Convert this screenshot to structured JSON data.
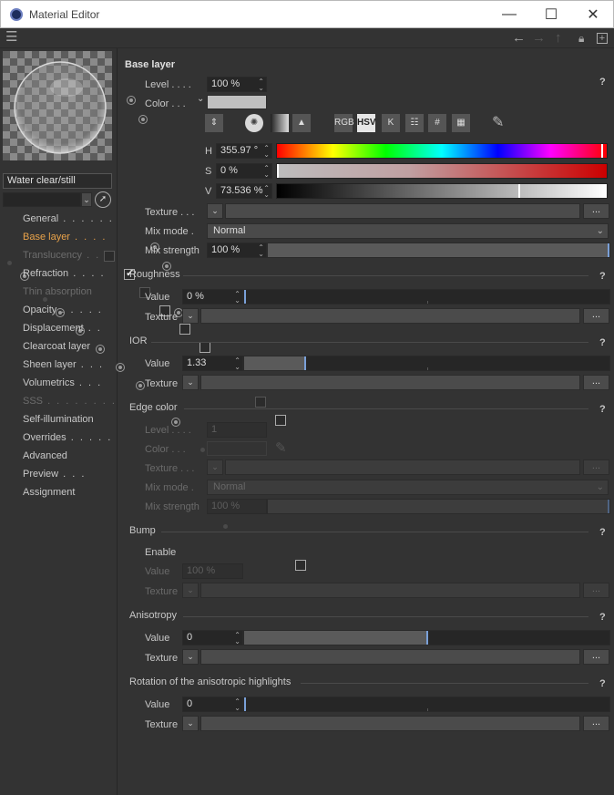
{
  "window": {
    "title": "Material Editor",
    "minimize_label": "—",
    "maximize_label": "☐",
    "close_label": "✕"
  },
  "sidebar": {
    "material_name": "Water clear/still",
    "items": [
      {
        "label": "General",
        "dots": ". . . . . .",
        "state": "none"
      },
      {
        "label": "Base layer",
        "dots": ". . . .",
        "state": "active"
      },
      {
        "label": "Translucency",
        "dots": ". .",
        "state": "disabled"
      },
      {
        "label": "Refraction",
        "dots": ". . . .",
        "state": "checked"
      },
      {
        "label": "Thin absorption",
        "dots": "",
        "state": "disabled"
      },
      {
        "label": "Opacity",
        "dots": ". . . . .",
        "state": "unchecked"
      },
      {
        "label": "Displacement",
        "dots": ". .",
        "state": "unchecked"
      },
      {
        "label": "Clearcoat layer",
        "dots": "",
        "state": "unchecked"
      },
      {
        "label": "Sheen layer",
        "dots": ". . .",
        "state": "unchecked"
      },
      {
        "label": "Volumetrics",
        "dots": ". . .",
        "state": "unchecked"
      },
      {
        "label": "SSS",
        "dots": ". . . . . . . .",
        "state": "disabled"
      },
      {
        "label": "Self-illumination",
        "dots": "",
        "state": "unchecked"
      },
      {
        "label": "Overrides",
        "dots": ". . . . .",
        "state": "none"
      },
      {
        "label": "Advanced",
        "dots": "",
        "state": "none"
      },
      {
        "label": "Preview",
        "dots": ". . .",
        "state": "none"
      },
      {
        "label": "Assignment",
        "dots": "",
        "state": "none"
      }
    ]
  },
  "base_layer": {
    "heading": "Base layer",
    "help": "?",
    "level_label": "Level . . . .",
    "level_value": "100 %",
    "level_fraction": 1.0,
    "color_label": "Color . . .",
    "color_swatch": "#bfbfbf",
    "color_modes": [
      "RGB",
      "HSV",
      "K"
    ],
    "selected_mode": "HSV",
    "h_label": "H",
    "h_value": "355.97 °",
    "h_fraction": 0.9888,
    "s_label": "S",
    "s_value": "0 %",
    "s_fraction": 0.0,
    "v_label": "V",
    "v_value": "73.536 %",
    "v_fraction": 0.73536,
    "texture_label": "Texture . . .",
    "ellipsis": "...",
    "mix_mode_label": "Mix mode .",
    "mix_mode_value": "Normal",
    "mix_strength_label": "Mix strength",
    "mix_strength_value": "100 %",
    "mix_strength_fraction": 1.0
  },
  "roughness": {
    "heading": "Roughness",
    "help": "?",
    "value_label": "Value",
    "value": "0 %",
    "value_fraction": 0.0,
    "texture_label": "Texture",
    "ellipsis": "..."
  },
  "ior": {
    "heading": "IOR",
    "help": "?",
    "value_label": "Value",
    "value": "1.33",
    "value_fraction": 0.165,
    "texture_label": "Texture",
    "ellipsis": "..."
  },
  "edge_color": {
    "heading": "Edge color",
    "help": "?",
    "level_label": "Level . . . .",
    "level_value": "1",
    "color_label": "Color . . .",
    "texture_label": "Texture . . .",
    "ellipsis": "...",
    "mix_mode_label": "Mix mode .",
    "mix_mode_value": "Normal",
    "mix_strength_label": "Mix strength",
    "mix_strength_value": "100 %",
    "mix_strength_fraction": 1.0
  },
  "bump": {
    "heading": "Bump",
    "help": "?",
    "enable_label": "Enable",
    "value_label": "Value",
    "value": "100 %",
    "texture_label": "Texture",
    "ellipsis": "..."
  },
  "anisotropy": {
    "heading": "Anisotropy",
    "help": "?",
    "value_label": "Value",
    "value": "0",
    "value_fraction": 0.5,
    "texture_label": "Texture",
    "ellipsis": "..."
  },
  "rotation": {
    "heading": "Rotation of the anisotropic highlights",
    "help": "?",
    "value_label": "Value",
    "value": "0",
    "value_fraction": 0.0,
    "texture_label": "Texture",
    "ellipsis": "..."
  }
}
